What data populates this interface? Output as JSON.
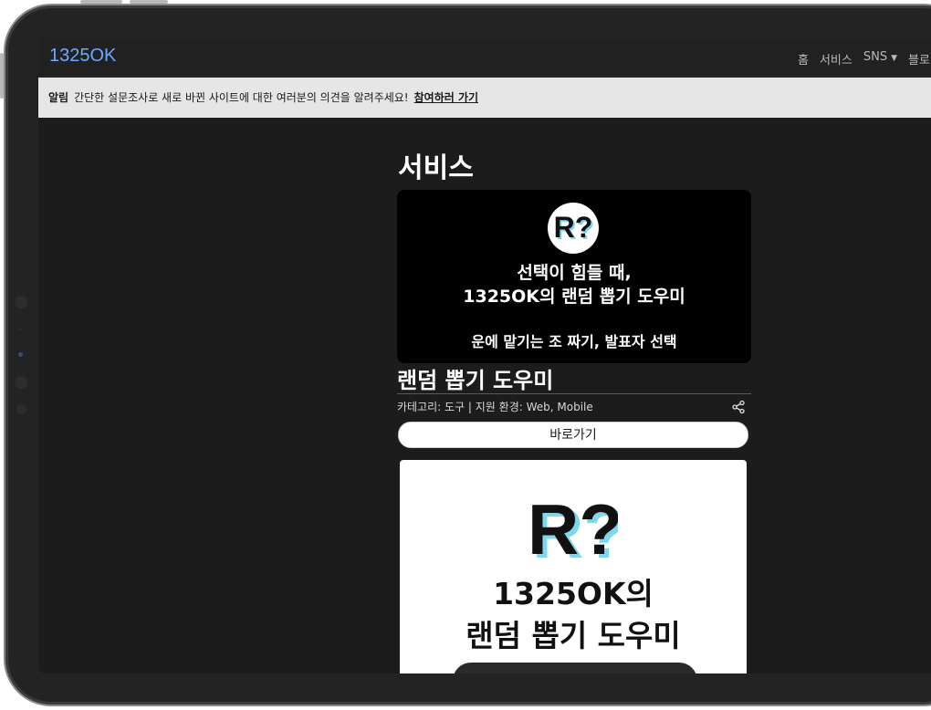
{
  "navbar": {
    "brand": "1325OK",
    "links": [
      {
        "label": "홈"
      },
      {
        "label": "서비스"
      },
      {
        "label": "SNS"
      },
      {
        "label": "블로"
      }
    ]
  },
  "alert": {
    "label": "알림",
    "message": "간단한 설문조사로 새로 바뀐 사이트에 대한 여러분의 의견을 알려주세요!",
    "link": "참여하러 가기"
  },
  "page": {
    "title": "서비스"
  },
  "banner": {
    "line1": "선택이 힘들 때,",
    "line2": "1325OK의 랜덤 뽑기 도우미",
    "line3": "운에 맡기는 조 짜기, 발표자 선택"
  },
  "service": {
    "title": "랜덤 뽑기 도우미",
    "meta": "카테고리: 도구  |  지원 환경: Web, Mobile",
    "button": "바로가기"
  },
  "preview": {
    "line1": "1325OK의",
    "line2": "랜덤 뽑기 도우미"
  },
  "icons": {
    "share": "share-icon",
    "logo": "r-question-logo-icon"
  }
}
